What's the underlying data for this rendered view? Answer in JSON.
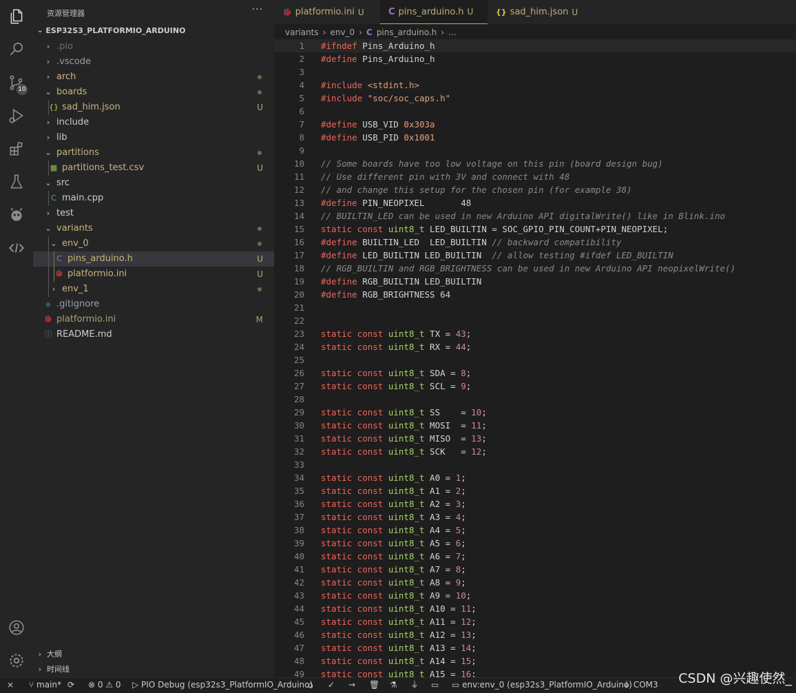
{
  "explorer": {
    "title": "资源管理器",
    "more": "···",
    "root": "ESP32S3_PLATFORMIO_ARDUINO",
    "items": [
      {
        "label": ".pio",
        "depth": 1,
        "folder": true,
        "open": false,
        "status": "",
        "dot": false,
        "icon": "",
        "color": "#6f6f6f"
      },
      {
        "label": ".vscode",
        "depth": 1,
        "folder": true,
        "open": false,
        "status": "",
        "dot": false,
        "icon": "",
        "color": "#9aa0a6"
      },
      {
        "label": "arch",
        "depth": 1,
        "folder": true,
        "open": false,
        "status": "",
        "dot": true,
        "icon": "",
        "color": "#c9b57d"
      },
      {
        "label": "boards",
        "depth": 1,
        "folder": true,
        "open": true,
        "status": "",
        "dot": true,
        "icon": "",
        "color": "#c9b57d"
      },
      {
        "label": "sad_him.json",
        "depth": 2,
        "folder": false,
        "status": "U",
        "dot": false,
        "icon": "{}",
        "color": "#c9b57d"
      },
      {
        "label": "include",
        "depth": 1,
        "folder": true,
        "open": false,
        "status": "",
        "dot": false,
        "icon": "",
        "color": "#cccccc"
      },
      {
        "label": "lib",
        "depth": 1,
        "folder": true,
        "open": false,
        "status": "",
        "dot": false,
        "icon": "",
        "color": "#cccccc"
      },
      {
        "label": "partitions",
        "depth": 1,
        "folder": true,
        "open": true,
        "status": "",
        "dot": true,
        "icon": "",
        "color": "#c9b57d"
      },
      {
        "label": "partitions_test.csv",
        "depth": 2,
        "folder": false,
        "status": "U",
        "dot": false,
        "icon": "▦",
        "color": "#c9b57d"
      },
      {
        "label": "src",
        "depth": 1,
        "folder": true,
        "open": true,
        "status": "",
        "dot": false,
        "icon": "",
        "color": "#cccccc"
      },
      {
        "label": "main.cpp",
        "depth": 2,
        "folder": false,
        "status": "",
        "dot": false,
        "icon": "C",
        "color": "#cccccc"
      },
      {
        "label": "test",
        "depth": 1,
        "folder": true,
        "open": false,
        "status": "",
        "dot": false,
        "icon": "",
        "color": "#cccccc"
      },
      {
        "label": "variants",
        "depth": 1,
        "folder": true,
        "open": true,
        "status": "",
        "dot": true,
        "icon": "",
        "color": "#c9b57d"
      },
      {
        "label": "env_0",
        "depth": 2,
        "folder": true,
        "open": true,
        "status": "",
        "dot": true,
        "icon": "",
        "color": "#c9b57d"
      },
      {
        "label": "pins_arduino.h",
        "depth": 3,
        "folder": false,
        "status": "U",
        "dot": false,
        "icon": "C",
        "color": "#c9b57d",
        "selected": true
      },
      {
        "label": "platformio.ini",
        "depth": 3,
        "folder": false,
        "status": "U",
        "dot": false,
        "icon": "🐞",
        "color": "#c9b57d"
      },
      {
        "label": "env_1",
        "depth": 2,
        "folder": true,
        "open": false,
        "status": "",
        "dot": true,
        "icon": "",
        "color": "#c9b57d"
      },
      {
        "label": ".gitignore",
        "depth": 1,
        "folder": false,
        "status": "",
        "dot": false,
        "icon": "◆",
        "color": "#9aa0a6"
      },
      {
        "label": "platformio.ini",
        "depth": 1,
        "folder": false,
        "status": "M",
        "dot": false,
        "icon": "🐞",
        "color": "#a8a46f"
      },
      {
        "label": "README.md",
        "depth": 1,
        "folder": false,
        "status": "",
        "dot": false,
        "icon": "ⓘ",
        "color": "#cccccc"
      }
    ],
    "outline": "大纲",
    "timeline": "时间线"
  },
  "activity": {
    "scm_badge": "10"
  },
  "tabs": [
    {
      "label": "platformio.ini",
      "status": "U",
      "icon": "🐞",
      "active": false
    },
    {
      "label": "pins_arduino.h",
      "status": "U",
      "icon": "C",
      "active": true
    },
    {
      "label": "sad_him.json",
      "status": "U",
      "icon": "{}",
      "active": false
    }
  ],
  "breadcrumb": [
    "variants",
    "env_0",
    "pins_arduino.h",
    "..."
  ],
  "code": [
    [
      [
        "k",
        "#ifndef"
      ],
      [
        "s",
        " Pins_Arduino_h"
      ]
    ],
    [
      [
        "k",
        "#define"
      ],
      [
        "s",
        " Pins_Arduino_h"
      ]
    ],
    [],
    [
      [
        "k",
        "#include"
      ],
      [
        "m",
        " <stdint.h>"
      ]
    ],
    [
      [
        "k",
        "#include"
      ],
      [
        "m",
        " \"soc/soc_caps.h\""
      ]
    ],
    [],
    [
      [
        "k",
        "#define"
      ],
      [
        "s",
        " USB_VID "
      ],
      [
        "m",
        "0x303a"
      ]
    ],
    [
      [
        "k",
        "#define"
      ],
      [
        "s",
        " USB_PID "
      ],
      [
        "m",
        "0x1001"
      ]
    ],
    [],
    [
      [
        "c",
        "// Some boards have too low voltage on this pin (board design bug)"
      ]
    ],
    [
      [
        "c",
        "// Use different pin with 3V and connect with 48"
      ]
    ],
    [
      [
        "c",
        "// and change this setup for the chosen pin (for example 38)"
      ]
    ],
    [
      [
        "k",
        "#define"
      ],
      [
        "s",
        " PIN_NEOPIXEL       48"
      ]
    ],
    [
      [
        "c",
        "// BUILTIN_LED can be used in new Arduino API digitalWrite() like in Blink.ino"
      ]
    ],
    [
      [
        "k",
        "static const"
      ],
      [
        "t",
        " uint8_t"
      ],
      [
        "s",
        " LED_BUILTIN = SOC_GPIO_PIN_COUNT+PIN_NEOPIXEL;"
      ]
    ],
    [
      [
        "k",
        "#define"
      ],
      [
        "s",
        " BUILTIN_LED  LED_BUILTIN "
      ],
      [
        "c",
        "// backward compatibility"
      ]
    ],
    [
      [
        "k",
        "#define"
      ],
      [
        "s",
        " LED_BUILTIN LED_BUILTIN  "
      ],
      [
        "c",
        "// allow testing #ifdef LED_BUILTIN"
      ]
    ],
    [
      [
        "c",
        "// RGB_BUILTIN and RGB_BRIGHTNESS can be used in new Arduino API neopixelWrite()"
      ]
    ],
    [
      [
        "k",
        "#define"
      ],
      [
        "s",
        " RGB_BUILTIN LED_BUILTIN"
      ]
    ],
    [
      [
        "k",
        "#define"
      ],
      [
        "s",
        " RGB_BRIGHTNESS 64"
      ]
    ],
    [],
    [],
    [
      [
        "k",
        "static const"
      ],
      [
        "t",
        " uint8_t"
      ],
      [
        "s",
        " TX = "
      ],
      [
        "n",
        "43"
      ],
      [
        "s",
        ";"
      ]
    ],
    [
      [
        "k",
        "static const"
      ],
      [
        "t",
        " uint8_t"
      ],
      [
        "s",
        " RX = "
      ],
      [
        "n",
        "44"
      ],
      [
        "s",
        ";"
      ]
    ],
    [],
    [
      [
        "k",
        "static const"
      ],
      [
        "t",
        " uint8_t"
      ],
      [
        "s",
        " SDA = "
      ],
      [
        "n",
        "8"
      ],
      [
        "s",
        ";"
      ]
    ],
    [
      [
        "k",
        "static const"
      ],
      [
        "t",
        " uint8_t"
      ],
      [
        "s",
        " SCL = "
      ],
      [
        "n",
        "9"
      ],
      [
        "s",
        ";"
      ]
    ],
    [],
    [
      [
        "k",
        "static const"
      ],
      [
        "t",
        " uint8_t"
      ],
      [
        "s",
        " SS    = "
      ],
      [
        "n",
        "10"
      ],
      [
        "s",
        ";"
      ]
    ],
    [
      [
        "k",
        "static const"
      ],
      [
        "t",
        " uint8_t"
      ],
      [
        "s",
        " MOSI  = "
      ],
      [
        "n",
        "11"
      ],
      [
        "s",
        ";"
      ]
    ],
    [
      [
        "k",
        "static const"
      ],
      [
        "t",
        " uint8_t"
      ],
      [
        "s",
        " MISO  = "
      ],
      [
        "n",
        "13"
      ],
      [
        "s",
        ";"
      ]
    ],
    [
      [
        "k",
        "static const"
      ],
      [
        "t",
        " uint8_t"
      ],
      [
        "s",
        " SCK   = "
      ],
      [
        "n",
        "12"
      ],
      [
        "s",
        ";"
      ]
    ],
    [],
    [
      [
        "k",
        "static const"
      ],
      [
        "t",
        " uint8_t"
      ],
      [
        "s",
        " A0 = "
      ],
      [
        "n",
        "1"
      ],
      [
        "s",
        ";"
      ]
    ],
    [
      [
        "k",
        "static const"
      ],
      [
        "t",
        " uint8_t"
      ],
      [
        "s",
        " A1 = "
      ],
      [
        "n",
        "2"
      ],
      [
        "s",
        ";"
      ]
    ],
    [
      [
        "k",
        "static const"
      ],
      [
        "t",
        " uint8_t"
      ],
      [
        "s",
        " A2 = "
      ],
      [
        "n",
        "3"
      ],
      [
        "s",
        ";"
      ]
    ],
    [
      [
        "k",
        "static const"
      ],
      [
        "t",
        " uint8_t"
      ],
      [
        "s",
        " A3 = "
      ],
      [
        "n",
        "4"
      ],
      [
        "s",
        ";"
      ]
    ],
    [
      [
        "k",
        "static const"
      ],
      [
        "t",
        " uint8_t"
      ],
      [
        "s",
        " A4 = "
      ],
      [
        "n",
        "5"
      ],
      [
        "s",
        ";"
      ]
    ],
    [
      [
        "k",
        "static const"
      ],
      [
        "t",
        " uint8_t"
      ],
      [
        "s",
        " A5 = "
      ],
      [
        "n",
        "6"
      ],
      [
        "s",
        ";"
      ]
    ],
    [
      [
        "k",
        "static const"
      ],
      [
        "t",
        " uint8_t"
      ],
      [
        "s",
        " A6 = "
      ],
      [
        "n",
        "7"
      ],
      [
        "s",
        ";"
      ]
    ],
    [
      [
        "k",
        "static const"
      ],
      [
        "t",
        " uint8_t"
      ],
      [
        "s",
        " A7 = "
      ],
      [
        "n",
        "8"
      ],
      [
        "s",
        ";"
      ]
    ],
    [
      [
        "k",
        "static const"
      ],
      [
        "t",
        " uint8_t"
      ],
      [
        "s",
        " A8 = "
      ],
      [
        "n",
        "9"
      ],
      [
        "s",
        ";"
      ]
    ],
    [
      [
        "k",
        "static const"
      ],
      [
        "t",
        " uint8_t"
      ],
      [
        "s",
        " A9 = "
      ],
      [
        "n",
        "10"
      ],
      [
        "s",
        ";"
      ]
    ],
    [
      [
        "k",
        "static const"
      ],
      [
        "t",
        " uint8_t"
      ],
      [
        "s",
        " A10 = "
      ],
      [
        "n",
        "11"
      ],
      [
        "s",
        ";"
      ]
    ],
    [
      [
        "k",
        "static const"
      ],
      [
        "t",
        " uint8_t"
      ],
      [
        "s",
        " A11 = "
      ],
      [
        "n",
        "12"
      ],
      [
        "s",
        ";"
      ]
    ],
    [
      [
        "k",
        "static const"
      ],
      [
        "t",
        " uint8_t"
      ],
      [
        "s",
        " A12 = "
      ],
      [
        "n",
        "13"
      ],
      [
        "s",
        ";"
      ]
    ],
    [
      [
        "k",
        "static const"
      ],
      [
        "t",
        " uint8_t"
      ],
      [
        "s",
        " A13 = "
      ],
      [
        "n",
        "14"
      ],
      [
        "s",
        ";"
      ]
    ],
    [
      [
        "k",
        "static const"
      ],
      [
        "t",
        " uint8_t"
      ],
      [
        "s",
        " A14 = "
      ],
      [
        "n",
        "15"
      ],
      [
        "s",
        ";"
      ]
    ],
    [
      [
        "k",
        "static const"
      ],
      [
        "t",
        " uint8_t"
      ],
      [
        "s",
        " A15 = "
      ],
      [
        "n",
        "16"
      ],
      [
        "s",
        ";"
      ]
    ]
  ],
  "status": {
    "branch": "main*",
    "problems": "0",
    "warnings": "0",
    "debug": "PIO Debug (esp32s3_PlatformIO_Arduino)",
    "env": "env:env_0 (esp32s3_PlatformIO_Arduino)",
    "port": "COM3"
  },
  "watermark": "CSDN @兴趣使然_",
  "colors": {
    "accent": "#bfae7a",
    "keyword": "#f0645b",
    "number": "#d2869e",
    "type": "#a6d36a"
  }
}
